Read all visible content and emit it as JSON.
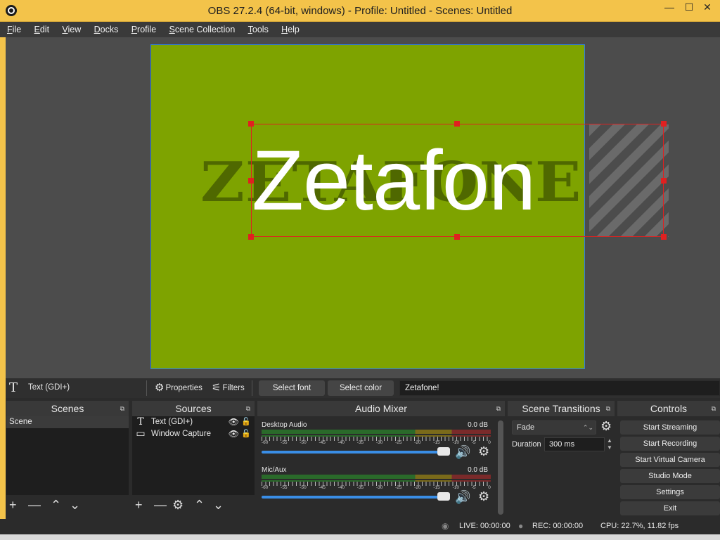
{
  "window": {
    "title": "OBS 27.2.4 (64-bit, windows) - Profile: Untitled - Scenes: Untitled",
    "minimize": "—",
    "maximize": "☐",
    "close": "✕"
  },
  "menu": [
    "File",
    "Edit",
    "View",
    "Docks",
    "Profile",
    "Scene Collection",
    "Tools",
    "Help"
  ],
  "preview": {
    "canvas_color": "#7ea300",
    "main_text": "Zetafon",
    "ghost_text": "ZETAFONE"
  },
  "source_toolbar": {
    "source_name": "Text (GDI+)",
    "properties": "Properties",
    "filters": "Filters",
    "select_font": "Select font",
    "select_color": "Select color",
    "text_value": "Zetafone!"
  },
  "scenes": {
    "title": "Scenes",
    "items": [
      "Scene"
    ]
  },
  "sources": {
    "title": "Sources",
    "items": [
      {
        "label": "Text (GDI+)",
        "icon": "text-icon"
      },
      {
        "label": "Window Capture",
        "icon": "window-icon"
      }
    ]
  },
  "mixer": {
    "title": "Audio Mixer",
    "ticks": [
      "-60",
      "-55",
      "-50",
      "-45",
      "-40",
      "-35",
      "-30",
      "-25",
      "-20",
      "-15",
      "-10",
      "-5",
      "0"
    ],
    "channels": [
      {
        "name": "Desktop Audio",
        "db": "0.0 dB"
      },
      {
        "name": "Mic/Aux",
        "db": "0.0 dB"
      }
    ]
  },
  "transitions": {
    "title": "Scene Transitions",
    "selected": "Fade",
    "duration_label": "Duration",
    "duration_value": "300 ms"
  },
  "controls": {
    "title": "Controls",
    "buttons": [
      "Start Streaming",
      "Start Recording",
      "Start Virtual Camera",
      "Studio Mode",
      "Settings",
      "Exit"
    ]
  },
  "status": {
    "live": "LIVE: 00:00:00",
    "rec": "REC: 00:00:00",
    "cpu": "CPU: 22.7%, 11.82 fps"
  }
}
